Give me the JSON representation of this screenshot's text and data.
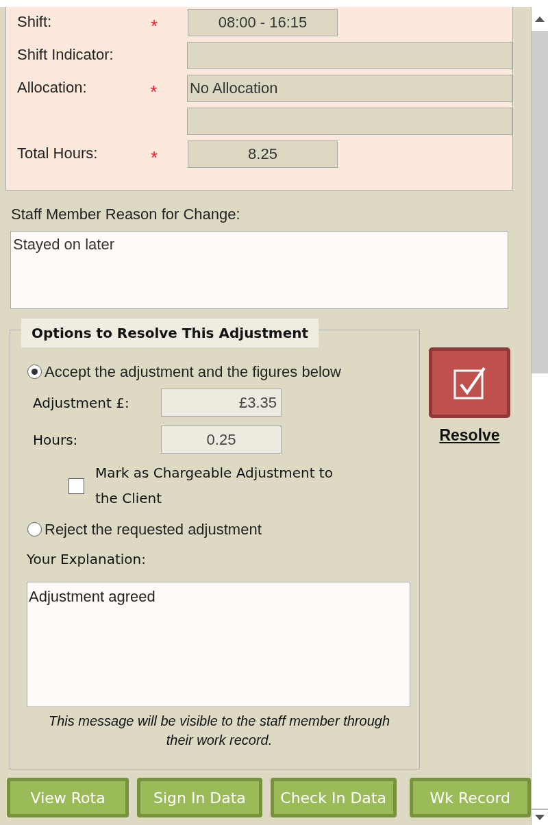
{
  "shift_details": {
    "fields": [
      {
        "label": "Shift:",
        "required_mark": "*",
        "kind": "short",
        "value": "08:00 - 16:15"
      },
      {
        "label": "Shift Indicator:",
        "kind": "long"
      },
      {
        "label": "Allocation:",
        "required_mark": "*",
        "kind": "long",
        "value": "No Allocation"
      },
      {
        "kind": "long"
      },
      {
        "label": "Total Hours:",
        "required_mark": "*",
        "kind": "short",
        "value": "8.25"
      }
    ]
  },
  "reason": {
    "label": "Staff Member Reason for Change:",
    "value": "Stayed on later"
  },
  "resolve_options": {
    "title": "Options to Resolve This Adjustment",
    "options": [
      {
        "label": "Accept the adjustment and the figures below",
        "selected": true
      },
      {
        "label": "Reject the requested adjustment",
        "selected": false
      }
    ],
    "adjustment": {
      "label": "Adjustment £:",
      "value": "£3.35"
    },
    "hours": {
      "label": "Hours:",
      "value": "0.25"
    },
    "chargeable": {
      "label": "Mark as Chargeable Adjustment to the Client",
      "checked": false
    },
    "explanation": {
      "label": "Your Explanation:",
      "value": "Adjustment agreed"
    },
    "note": "This message will be visible to the staff member through their work record."
  },
  "resolve_button": {
    "label": "Resolve"
  },
  "buttons": [
    "View Rota",
    "Sign In Data",
    "Check In Data",
    "Wk Record"
  ]
}
